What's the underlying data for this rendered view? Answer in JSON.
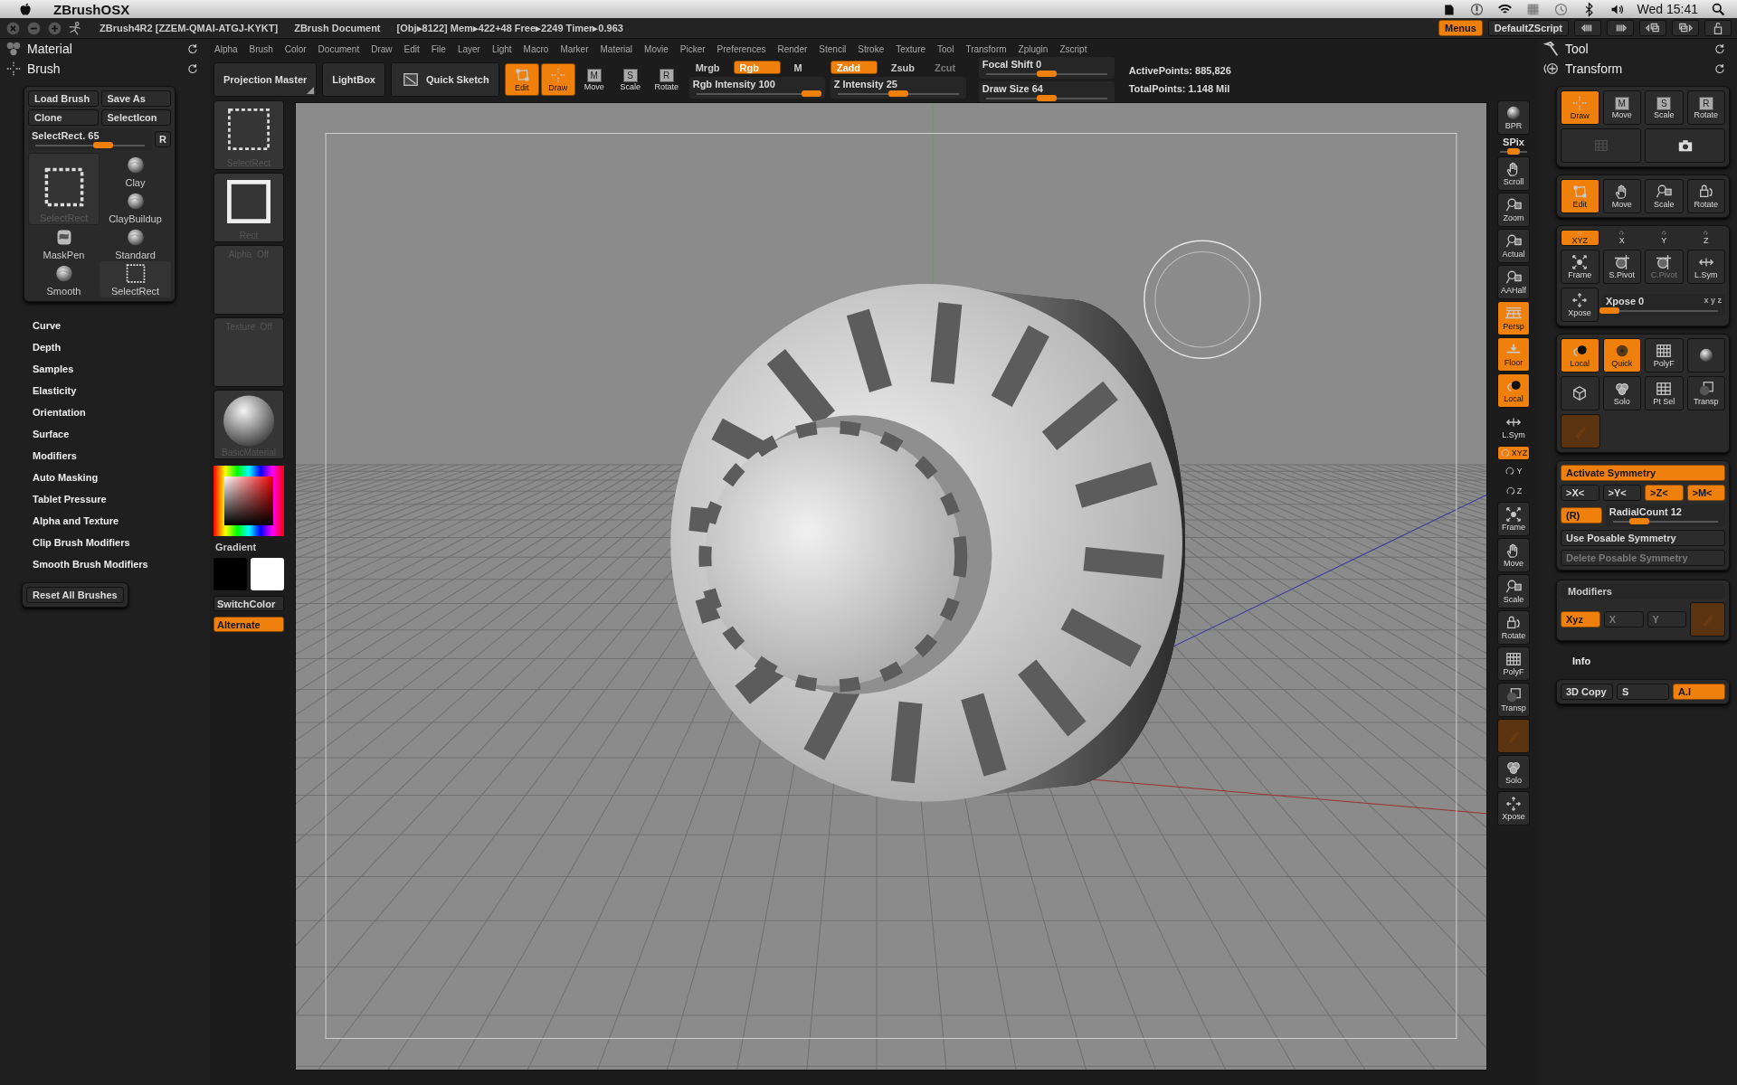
{
  "mac_menubar": {
    "app_name": "ZBrushOSX",
    "clock": "Wed 15:41"
  },
  "title_bar": {
    "version": "ZBrush4R2 [ZZEM-QMAI-ATGJ-KYKT]",
    "document": "ZBrush Document",
    "stats": "[Obj▸8122] Mem▸422+48 Free▸2249 Timer▸0.963",
    "buttons": [
      {
        "label": "Menus",
        "on": true
      },
      {
        "label": "DefaultZScript",
        "on": false
      }
    ]
  },
  "menu": [
    "Alpha",
    "Brush",
    "Color",
    "Document",
    "Draw",
    "Edit",
    "File",
    "Layer",
    "Light",
    "Macro",
    "Marker",
    "Material",
    "Movie",
    "Picker",
    "Preferences",
    "Render",
    "Stencil",
    "Stroke",
    "Texture",
    "Tool",
    "Transform",
    "Zplugin",
    "Zscript"
  ],
  "left_panel": {
    "palettes": [
      {
        "title": "Material",
        "kind": "spheres"
      },
      {
        "title": "Brush",
        "kind": "crosshair"
      }
    ],
    "buttons": [
      "Load Brush",
      "Save As",
      "Clone",
      "SelectIcon"
    ],
    "slider": {
      "label": "SelectRect. 65",
      "level": 0.62
    },
    "reset_key": "R",
    "brushes": [
      {
        "name": "SelectRect",
        "kind": "rect",
        "selected": true
      },
      {
        "name": "MaskPen",
        "kind": "maskpen",
        "selected": false
      },
      {
        "name": "Smooth",
        "kind": "ball",
        "selected": false
      },
      {
        "name": "Clay",
        "kind": "ball",
        "selected": false
      },
      {
        "name": "ClayBuildup",
        "kind": "ball",
        "selected": false
      },
      {
        "name": "Standard",
        "kind": "ball",
        "selected": false
      },
      {
        "name": "SelectRect",
        "kind": "rect",
        "selected": false
      }
    ],
    "sections": [
      "Curve",
      "Depth",
      "Samples",
      "Elasticity",
      "Orientation",
      "Surface",
      "Modifiers",
      "Auto Masking",
      "Tablet Pressure",
      "Alpha and Texture",
      "Clip Brush Modifiers",
      "Smooth Brush Modifiers"
    ],
    "reset_button": "Reset All Brushes"
  },
  "top_shelf": {
    "large": [
      {
        "label": "Projection Master",
        "kind": "corner"
      },
      {
        "label": "LightBox",
        "kind": "plain"
      },
      {
        "label": "Quick Sketch",
        "kind": "sketch"
      }
    ],
    "modes": [
      {
        "label": "Edit",
        "kind": "edit",
        "on": true
      },
      {
        "label": "Draw",
        "kind": "crosshair",
        "on": true
      },
      {
        "label": "Move",
        "glyph": "M",
        "on": false
      },
      {
        "label": "Scale",
        "glyph": "S",
        "on": false
      },
      {
        "label": "Rotate",
        "glyph": "R",
        "on": false
      }
    ],
    "rgb_toggles": [
      {
        "label": "Mrgb",
        "on": false
      },
      {
        "label": "Rgb",
        "on": true
      },
      {
        "label": "M",
        "on": false
      }
    ],
    "rgb_intensity": {
      "label": "Rgb Intensity 100",
      "level": 0.95
    },
    "z_toggles": [
      {
        "label": "Zadd",
        "on": true,
        "disabled": false
      },
      {
        "label": "Zsub",
        "on": false,
        "disabled": false
      },
      {
        "label": "Zcut",
        "on": false,
        "disabled": true
      }
    ],
    "z_intensity": {
      "label": "Z Intensity 25",
      "level": 0.5
    },
    "focal_shift": {
      "label": "Focal Shift 0",
      "level": 0.5
    },
    "draw_size": {
      "label": "Draw Size 64",
      "level": 0.5
    },
    "stats": [
      "ActivePoints: 885,826",
      "TotalPoints: 1.148 Mil"
    ]
  },
  "left_shelf": {
    "tiles": [
      {
        "label": "SelectRect",
        "kind": "rect"
      },
      {
        "label": "Rect",
        "kind": "square"
      },
      {
        "label": "Alpha  Off",
        "kind": "empty"
      },
      {
        "label": "Texture  Off",
        "kind": "empty"
      },
      {
        "label": "BasicMaterial",
        "kind": "sphere"
      }
    ],
    "gradient_label": "Gradient",
    "swatches": [
      {
        "color": "#000000"
      },
      {
        "color": "#ffffff"
      }
    ],
    "switch_color": {
      "label": "SwitchColor",
      "on": false
    },
    "alternate": {
      "label": "Alternate",
      "on": true
    }
  },
  "right_toolbar": [
    {
      "label": "BPR",
      "kind": "sphere",
      "on": false
    },
    {
      "label": "SPix",
      "kind": "slider",
      "level": 0.5
    },
    {
      "label": "Scroll",
      "kind": "hand",
      "on": false
    },
    {
      "label": "Zoom",
      "kind": "magnifier",
      "on": false
    },
    {
      "label": "Actual",
      "kind": "magnifier",
      "on": false
    },
    {
      "label": "AAHalf",
      "kind": "magnifier",
      "on": false
    },
    {
      "label": "Persp",
      "kind": "persp",
      "on": true
    },
    {
      "label": "Floor",
      "kind": "floor",
      "on": true
    },
    {
      "label": "Local",
      "kind": "local",
      "on": true
    },
    {
      "label": "L.Sym",
      "kind": "lsym",
      "on": false
    },
    {
      "label": "XYZ",
      "kind": "pill",
      "on": true
    },
    {
      "label": "Y",
      "kind": "rotsmall",
      "on": false
    },
    {
      "label": "Z",
      "kind": "rotsmall",
      "on": false
    },
    {
      "label": "Frame",
      "kind": "frame",
      "on": false
    },
    {
      "label": "Move",
      "kind": "hand",
      "on": false
    },
    {
      "label": "Scale",
      "kind": "magnifier",
      "on": false
    },
    {
      "label": "Rotate",
      "kind": "rotlock",
      "on": false
    },
    {
      "label": "PolyF",
      "kind": "grid",
      "on": false
    },
    {
      "label": "Transp",
      "kind": "transp",
      "on": false
    },
    {
      "kind": "ghostorange",
      "on": true,
      "disabled": true
    },
    {
      "label": "Solo",
      "kind": "solo",
      "on": false
    },
    {
      "label": "Xpose",
      "kind": "xpose",
      "on": false
    }
  ],
  "right_panel": {
    "palettes": [
      {
        "title": "Tool",
        "kind": "hammer"
      },
      {
        "title": "Transform",
        "kind": "transform"
      }
    ],
    "groups": [
      {
        "rows": [
          [
            {
              "label": "Draw",
              "kind": "crosshair",
              "on": true
            },
            {
              "label": "Move",
              "glyph": "M",
              "on": false
            },
            {
              "label": "Scale",
              "glyph": "S",
              "on": false
            },
            {
              "label": "Rotate",
              "glyph": "R",
              "on": false
            }
          ],
          [
            {
              "kind": "ghostgrid",
              "on": false
            },
            {
              "kind": "camera",
              "on": false
            }
          ]
        ]
      },
      {
        "rows": [
          [
            {
              "label": "Edit",
              "kind": "edit",
              "on": true
            },
            {
              "label": "Move",
              "kind": "hand",
              "on": false
            },
            {
              "label": "Scale",
              "kind": "magnifier",
              "on": false
            },
            {
              "label": "Rotate",
              "kind": "rotlock",
              "on": false
            }
          ]
        ]
      },
      {
        "rows": [
          [
            {
              "label": "XYZ",
              "kind": "pill",
              "on": true
            },
            {
              "label": "X",
              "kind": "rotsmall",
              "on": false
            },
            {
              "label": "Y",
              "kind": "rotsmall",
              "on": false
            },
            {
              "label": "Z",
              "kind": "rotsmall",
              "on": false
            }
          ],
          [
            {
              "label": "Frame",
              "kind": "frame",
              "on": false,
              "disabled": false
            },
            {
              "label": "S.Pivot",
              "kind": "pivot",
              "on": false,
              "disabled": false
            },
            {
              "label": "C.Pivot",
              "kind": "pivot",
              "on": false,
              "disabled": true
            },
            {
              "label": "L.Sym",
              "kind": "lsym",
              "on": false,
              "disabled": false
            }
          ],
          [
            {
              "label": "Xpose",
              "kind": "xpose",
              "on": false
            },
            {
              "label": "Xpose 0",
              "note": "x y z",
              "kind": "slider",
              "level": 0
            }
          ]
        ]
      },
      {
        "rows": [
          [
            {
              "label": "Local",
              "kind": "local",
              "on": true
            },
            {
              "label": "Quick",
              "kind": "quick",
              "on": true
            },
            {
              "label": "PolyF",
              "kind": "grid",
              "on": false
            },
            {
              "kind": "sphere",
              "on": false
            }
          ],
          [
            {
              "kind": "cube",
              "on": false
            },
            {
              "label": "Solo",
              "kind": "solo",
              "on": false
            },
            {
              "label": "Pt Sel",
              "kind": "ptsel",
              "on": false
            },
            {
              "label": "Transp",
              "kind": "transp",
              "on": false
            }
          ],
          [
            {
              "kind": "ghostorange",
              "on": true,
              "disabled": true
            },
            {
              "kind": "spacer"
            },
            {
              "kind": "spacer"
            },
            {
              "kind": "spacer"
            }
          ]
        ]
      },
      {
        "rows": [
          [
            {
              "label": "Activate Symmetry",
              "kind": "text",
              "on": true
            }
          ],
          [
            {
              "label": ">X<",
              "kind": "text",
              "on": false
            },
            {
              "label": ">Y<",
              "kind": "text",
              "on": false
            },
            {
              "label": ">Z<",
              "kind": "text",
              "on": true
            },
            {
              "label": ">M<",
              "kind": "text",
              "on": true
            }
          ],
          [
            {
              "label": "(R)",
              "kind": "text",
              "on": true
            },
            {
              "label": "RadialCount 12",
              "kind": "slider",
              "level": 0.25
            }
          ],
          [
            {
              "label": "Use Posable Symmetry",
              "kind": "text",
              "on": false,
              "disabled": false
            }
          ],
          [
            {
              "label": "Delete Posable Symmetry",
              "kind": "text",
              "on": false,
              "disabled": true
            }
          ]
        ]
      }
    ],
    "modifiers": {
      "title": "Modifiers",
      "row": [
        {
          "label": "Xyz",
          "kind": "text",
          "on": true,
          "disabled": false
        },
        {
          "label": "X",
          "kind": "text",
          "on": false,
          "disabled": true
        },
        {
          "label": "Y",
          "kind": "text",
          "on": false,
          "disabled": true
        },
        {
          "kind": "ghostorange",
          "on": true,
          "disabled": true
        }
      ]
    },
    "info": "Info",
    "bottom_row": [
      {
        "label": "3D Copy",
        "kind": "text",
        "on": false
      },
      {
        "label": "S",
        "kind": "text",
        "on": false
      },
      {
        "label": "A.I",
        "kind": "text",
        "on": true
      }
    ]
  }
}
